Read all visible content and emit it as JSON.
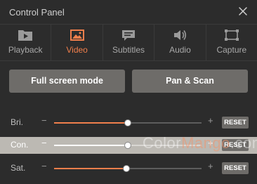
{
  "window": {
    "title": "Control Panel"
  },
  "tabs": [
    {
      "label": "Playback",
      "icon": "playback-folder-icon"
    },
    {
      "label": "Video",
      "icon": "video-image-icon",
      "active": true
    },
    {
      "label": "Subtitles",
      "icon": "subtitles-icon"
    },
    {
      "label": "Audio",
      "icon": "audio-speaker-icon"
    },
    {
      "label": "Capture",
      "icon": "capture-frame-icon"
    }
  ],
  "buttons": {
    "fullscreen": "Full screen mode",
    "pan_scan": "Pan & Scan"
  },
  "sliders": [
    {
      "label": "Bri.",
      "value_pct": 50,
      "reset": "RESET"
    },
    {
      "label": "Con.",
      "value_pct": 50,
      "reset": "RESET",
      "highlighted": true
    },
    {
      "label": "Sat.",
      "value_pct": 49,
      "reset": "RESET"
    }
  ],
  "symbols": {
    "minus": "−",
    "plus": "+"
  },
  "colors": {
    "accent": "#f07f4c",
    "background": "#2c2c2c",
    "button": "#6e6c69"
  },
  "watermark": {
    "left": "Color",
    "mid": "Mango",
    "right": ".com"
  }
}
